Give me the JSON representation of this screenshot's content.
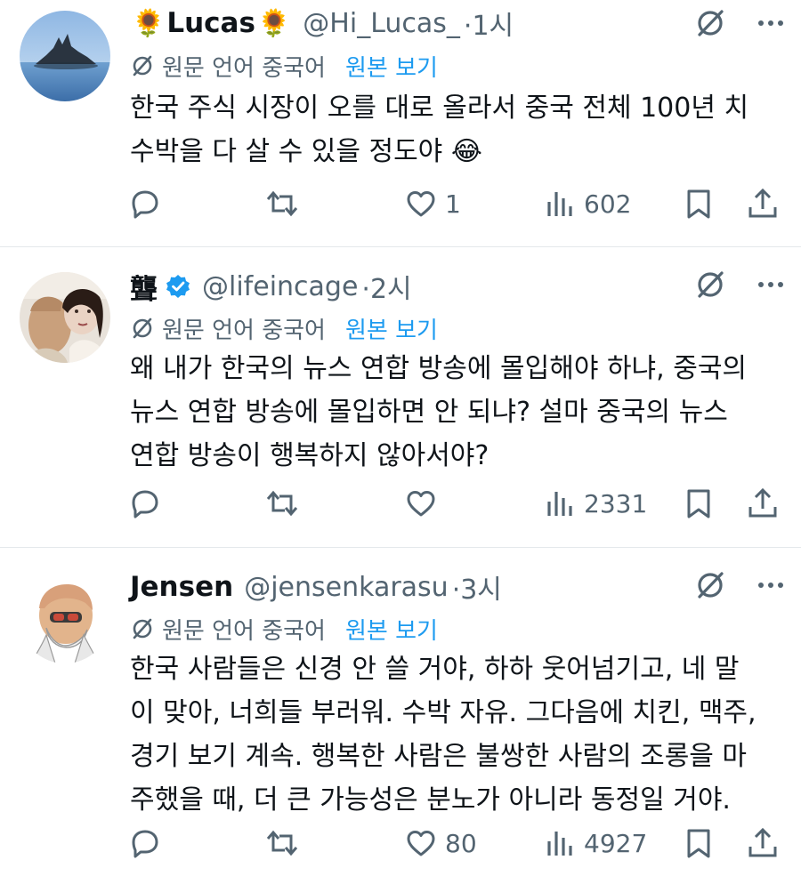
{
  "translation": {
    "source_label": "원문 언어 중국어",
    "show_original": "원본 보기"
  },
  "tweets": [
    {
      "name": "Lucas",
      "name_prefix_emoji": "🌻",
      "name_suffix_emoji": "🌻",
      "handle": "@Hi_Lucas_",
      "time": "·1시",
      "verified": false,
      "lines": [
        "한국 주식 시장이 오를 대로 올라서 중국 전체 100년 치",
        "수박을 다 살 수 있을 정도야 😂"
      ],
      "replies": "",
      "reposts": "",
      "likes": "1",
      "views": "602"
    },
    {
      "name": "聾",
      "handle": "@lifeincage",
      "time": "·2시",
      "verified": true,
      "lines": [
        "왜 내가 한국의 뉴스 연합 방송에 몰입해야 하냐, 중국의",
        "뉴스 연합 방송에 몰입하면 안 되냐? 설마 중국의 뉴스",
        "연합 방송이 행복하지 않아서야?"
      ],
      "replies": "",
      "reposts": "",
      "likes": "",
      "views": "2331"
    },
    {
      "name": "Jensen",
      "handle": "@jensenkarasu",
      "time": "·3시",
      "verified": false,
      "lines": [
        "한국 사람들은 신경 안 쓸 거야, 하하 웃어넘기고, 네 말",
        "이 맞아, 너희들 부러워. 수박 자유. 그다음에 치킨, 맥주,",
        "경기 보기 계속. 행복한 사람은 불쌍한 사람의 조롱을 마",
        "주했을 때, 더 큰 가능성은 분노가 아니라 동정일 거야."
      ],
      "replies": "",
      "reposts": "",
      "likes": "80",
      "views": "4927"
    }
  ],
  "icons": {
    "grok": "grok-slash-icon",
    "more": "more-dots-icon",
    "translate": "translate-slash-icon",
    "reply": "reply-icon",
    "repost": "repost-icon",
    "like": "heart-icon",
    "views": "views-bar-icon",
    "bookmark": "bookmark-icon",
    "share": "share-icon"
  },
  "colors": {
    "text": "#0f1419",
    "secondary": "#536471",
    "accent": "#1d9bf0",
    "divider": "#e4e8eb"
  }
}
